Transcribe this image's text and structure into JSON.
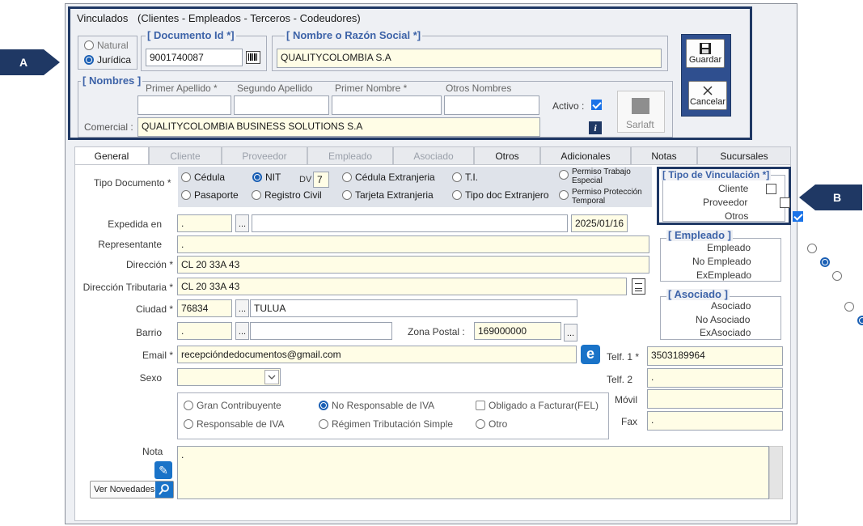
{
  "header": {
    "title": "Vinculados",
    "subtitle": "(Clientes - Empleados - Terceros - Codeudores)",
    "person_type": {
      "natural": "Natural",
      "juridica": "Jurídica",
      "selected": "juridica"
    },
    "documento": {
      "label": "[ Documento Id *]",
      "value": "9001740087"
    },
    "nombre": {
      "label": "[ Nombre o Razón Social *]",
      "value": "QUALITYCOLOMBIA S.A"
    },
    "nombres": {
      "label": "[ Nombres ]",
      "primer_apellido": "Primer Apellido *",
      "segundo_apellido": "Segundo Apellido",
      "primer_nombre": "Primer Nombre *",
      "otros_nombres": "Otros Nombres",
      "values": [
        "",
        "",
        "",
        ""
      ]
    },
    "activo_label": "Activo :",
    "comercial_label": "Comercial :",
    "comercial_value": "QUALITYCOLOMBIA BUSINESS SOLUTIONS S.A",
    "sarlaft_label": "Sarlaft",
    "guardar_label": "Guardar",
    "cancelar_label": "Cancelar"
  },
  "markers": {
    "a": "A",
    "b": "B"
  },
  "tabs": [
    "General",
    "Cliente",
    "Proveedor",
    "Empleado",
    "Asociado",
    "Otros",
    "Adicionales",
    "Notas",
    "Sucursales"
  ],
  "tipo_documento": {
    "label": "Tipo Documento *",
    "options": [
      "Cédula",
      "NIT",
      "Cédula Extranjeria",
      "T.I.",
      "Permiso Trabajo Especial",
      "Pasaporte",
      "Registro Civil",
      "Tarjeta Extranjeria",
      "Tipo doc Extranjero",
      "Permiso Protección Temporal"
    ],
    "selected": "NIT",
    "dv_label": "DV",
    "dv_value": "7"
  },
  "fields": {
    "expedida_label": "Expedida en",
    "expedida_code": ".",
    "expedida_name": "",
    "expedida_date": "2025/01/16",
    "representante_label": "Representante",
    "representante_value": ".",
    "direccion_label": "Dirección *",
    "direccion_value": "CL 20 33A 43",
    "dir_trib_label": "Dirección Tributaria *",
    "dir_trib_value": "CL 20 33A 43",
    "ciudad_label": "Ciudad *",
    "ciudad_code": "76834",
    "ciudad_name": "TULUA",
    "barrio_label": "Barrio",
    "barrio_code": ".",
    "barrio_name": "",
    "zona_label": "Zona Postal :",
    "zona_value": "169000000",
    "email_label": "Email *",
    "email_value": "recepcióndedocumentos@gmail.com",
    "sexo_label": "Sexo",
    "sexo_value": "",
    "telf1_label": "Telf. 1 *",
    "telf1_value": "3503189964",
    "telf2_label": "Telf. 2",
    "telf2_value": ".",
    "movil_label": "Móvil",
    "movil_value": "",
    "fax_label": "Fax",
    "fax_value": ".",
    "nota_label": "Nota",
    "nota_value": ".",
    "ver_novedades": "Ver Novedades"
  },
  "tributario": {
    "options": [
      "Gran Contribuyente",
      "No Responsable de IVA",
      "Obligado a Facturar(FEL)",
      "Responsable de IVA",
      "Régimen Tributación Simple",
      "Otro"
    ],
    "selected": "No Responsable de IVA"
  },
  "vinculacion": {
    "title": "[ Tipo de Vinculación *]",
    "cliente": "Cliente",
    "proveedor": "Proveedor",
    "otros": "Otros",
    "checked": "Otros"
  },
  "empleado": {
    "title": "[ Empleado ]",
    "options": [
      "Empleado",
      "No Empleado",
      "ExEmpleado"
    ],
    "selected": "No Empleado"
  },
  "asociado": {
    "title": "[ Asociado ]",
    "options": [
      "Asociado",
      "No Asociado",
      "ExAsociado"
    ],
    "selected": "No Asociado"
  },
  "colors": {
    "navy": "#1f3864",
    "accent": "#1a5fb4",
    "field": "#fffde6",
    "label_blue": "#3d63a8"
  }
}
